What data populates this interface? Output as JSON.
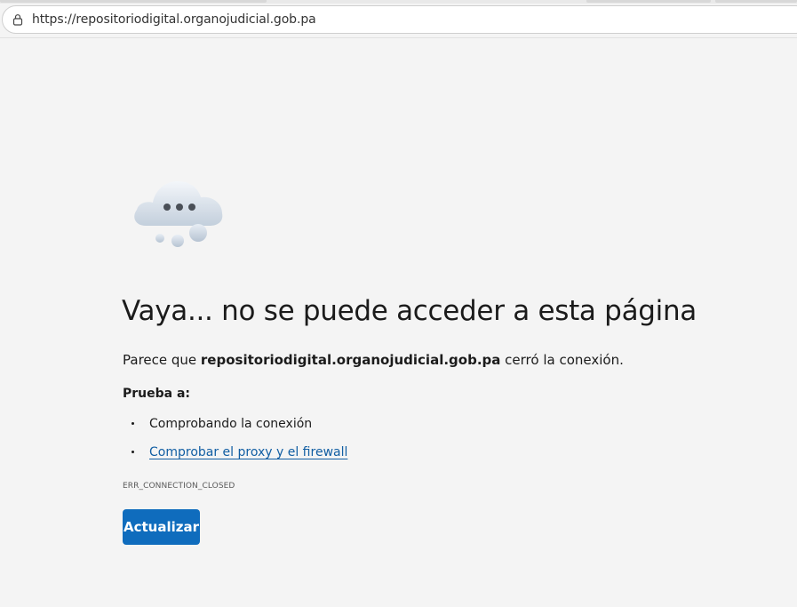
{
  "browser": {
    "url": "https://repositoriodigital.organojudicial.gob.pa"
  },
  "error_page": {
    "title": "Vaya... no se puede acceder a esta página",
    "description_prefix": "Parece que ",
    "description_host": "repositoriodigital.organojudicial.gob.pa",
    "description_suffix": " cerró la conexión.",
    "try_heading": "Prueba a:",
    "suggestions": [
      {
        "label": "Comprobando la conexión",
        "is_link": false
      },
      {
        "label": "Comprobar el proxy y el firewall",
        "is_link": true
      }
    ],
    "error_code": "ERR_CONNECTION_CLOSED",
    "refresh_label": "Actualizar",
    "illustration": "cloud-with-ellipsis-icon"
  },
  "colors": {
    "page_background": "#f4f4f4",
    "button_background": "#0f6cbd",
    "link": "#115ea3"
  }
}
